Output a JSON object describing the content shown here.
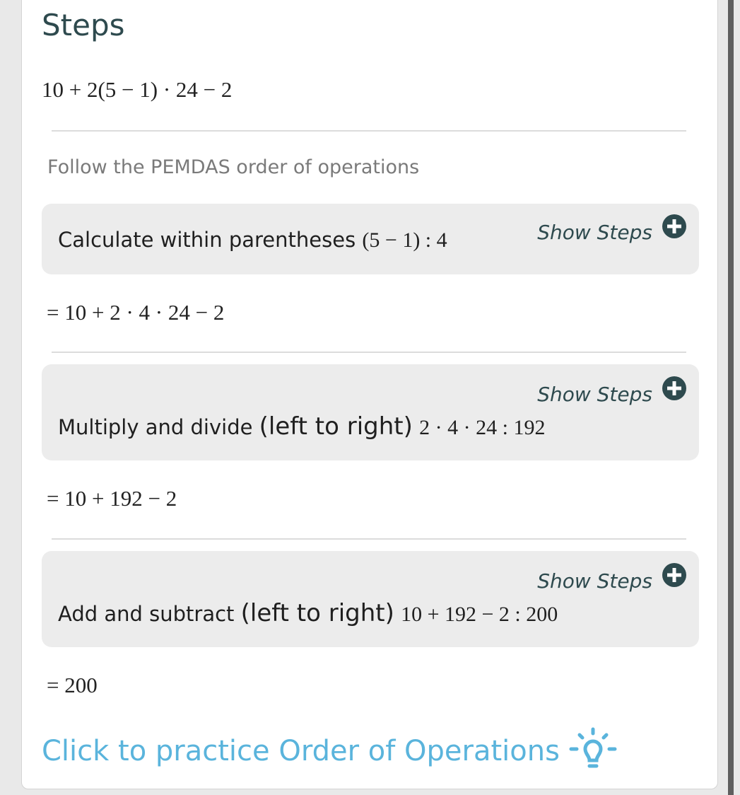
{
  "title": "Steps",
  "expression": "10 + 2(5 − 1) ·  24 − 2",
  "hint": "Follow the PEMDAS order of operations",
  "steps": [
    {
      "text": "Calculate within parentheses",
      "math": "(5 − 1) :   4",
      "show_steps": "Show Steps",
      "result": "= 10 + 2 ·  4 ·  24 − 2"
    },
    {
      "text": "Multiply and divide",
      "paren_text": "(left to right)",
      "math": "2 ·  4 ·  24 :   192",
      "show_steps": "Show Steps",
      "result": "= 10 + 192 − 2"
    },
    {
      "text": "Add and subtract",
      "paren_text": "(left to right)",
      "math": "10 + 192 − 2 :   200",
      "show_steps": "Show Steps",
      "result": "= 200"
    }
  ],
  "practice_link": "Click to practice Order of Operations",
  "icons": {
    "show_steps": "plus-circle-icon",
    "practice": "lightbulb-icon"
  },
  "colors": {
    "title": "#2e4a4e",
    "link": "#5ab4dc",
    "step_bg": "#ececec"
  }
}
